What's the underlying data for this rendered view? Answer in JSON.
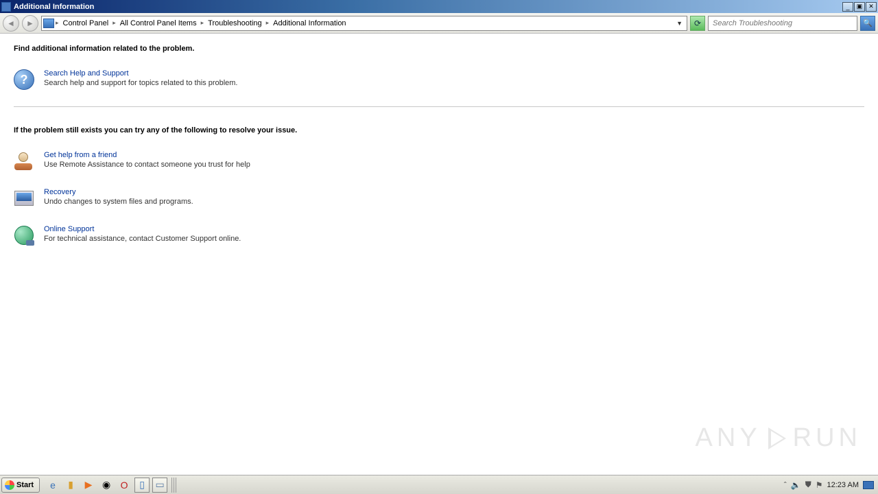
{
  "window": {
    "title": "Additional Information"
  },
  "breadcrumb": {
    "items": [
      "Control Panel",
      "All Control Panel Items",
      "Troubleshooting",
      "Additional Information"
    ]
  },
  "search": {
    "placeholder": "Search Troubleshooting"
  },
  "content": {
    "heading1": "Find additional information related to the problem.",
    "help_link": "Search Help and Support",
    "help_desc": "Search help and support for topics related to this problem.",
    "heading2": "If the problem still exists you can try any of the following to resolve your issue.",
    "options": [
      {
        "icon": "friend-icon",
        "link": "Get help from a friend",
        "desc": "Use Remote Assistance to contact someone you trust for help"
      },
      {
        "icon": "recovery-icon",
        "link": "Recovery",
        "desc": "Undo changes to system files and programs."
      },
      {
        "icon": "online-icon",
        "link": "Online Support",
        "desc": "For technical assistance, contact Customer Support online."
      }
    ]
  },
  "taskbar": {
    "start": "Start",
    "clock": "12:23 AM"
  },
  "watermark": {
    "left": "ANY",
    "right": "RUN"
  }
}
